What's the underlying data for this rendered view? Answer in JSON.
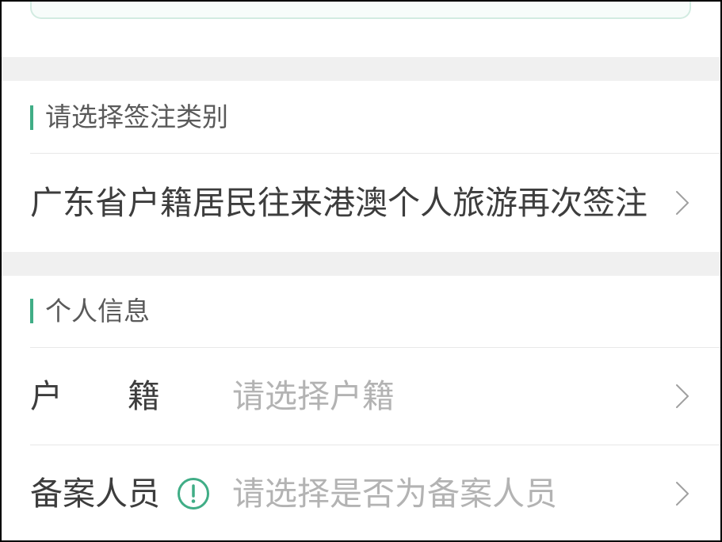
{
  "colors": {
    "accent": "#40ad86",
    "text_primary": "#3d3d3d",
    "text_secondary": "#5a5a5a",
    "placeholder": "#b3b3b3",
    "separator": "#f0f0f0",
    "divider": "#e8e8e8",
    "chevron": "#a0a0a0"
  },
  "visa_category_section": {
    "title": "请选择签注类别",
    "selected": "广东省户籍居民往来港澳个人旅游再次签注",
    "chevron_icon": "chevron-right-icon"
  },
  "personal_info_section": {
    "title": "个人信息",
    "household_registration": {
      "label_chars": [
        "户",
        "籍"
      ],
      "placeholder": "请选择户籍",
      "chevron_icon": "chevron-right-icon"
    },
    "filing_person": {
      "label": "备案人员",
      "info_icon": "exclamation-circle-icon",
      "placeholder": "请选择是否为备案人员",
      "chevron_icon": "chevron-right-icon"
    }
  }
}
